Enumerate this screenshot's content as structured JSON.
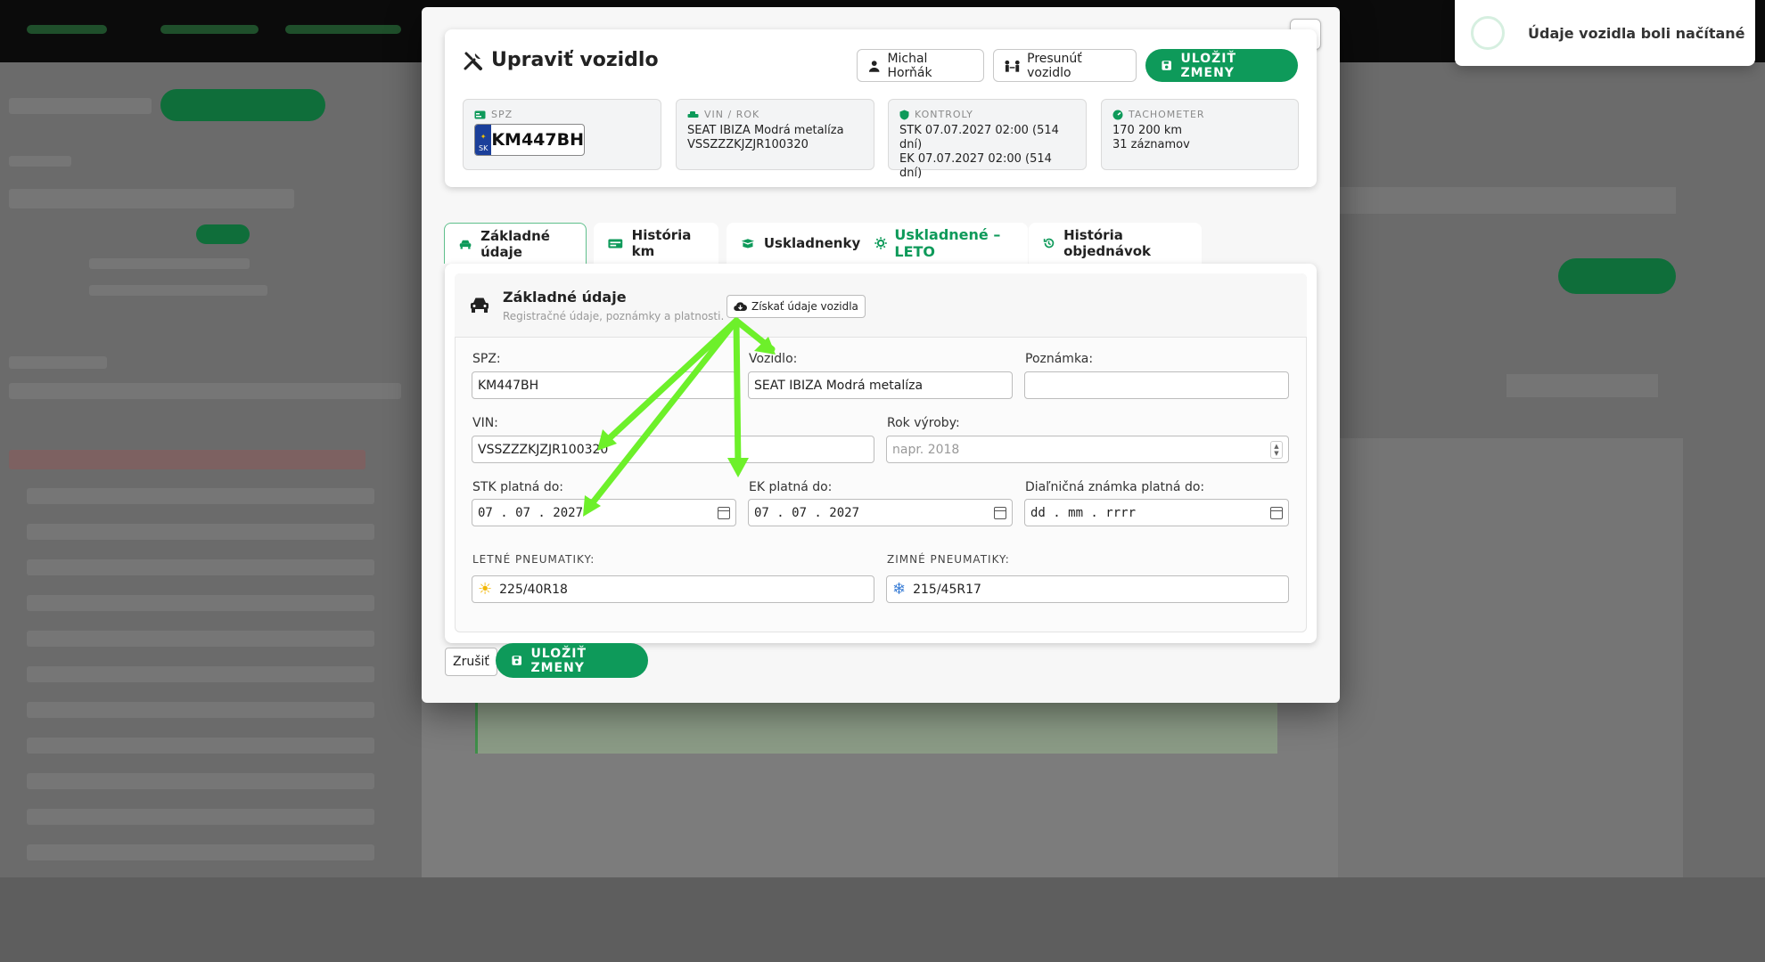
{
  "modal": {
    "title": "Upraviť vozidlo",
    "owner_button": "Michal Horňák",
    "move_button": "Presunúť vozidlo",
    "save_button": "ULOŽIŤ ZMENY",
    "close_label": "×"
  },
  "info": {
    "spz_label": "SPZ",
    "plate_country": "SK",
    "plate_number": "KM447BH",
    "vin_label": "VIN / ROK",
    "vin_line1": "SEAT IBIZA Modrá metalíza",
    "vin_line2": "VSSZZZKJZJR100320",
    "checks_label": "KONTROLY",
    "checks_line1": "STK 07.07.2027 02:00 (514 dní)",
    "checks_line2": "EK 07.07.2027 02:00 (514 dní)",
    "odo_label": "TACHOMETER",
    "odo_line1": "170 200 km",
    "odo_line2": "31 záznamov"
  },
  "tabs": [
    {
      "label": "Základné údaje"
    },
    {
      "label": "História km"
    },
    {
      "label": "Uskladnenky",
      "status": "Uskladnené – LETO"
    },
    {
      "label": "História objednávok"
    }
  ],
  "section": {
    "title": "Základné údaje",
    "subtitle": "Registračné údaje, poznámky a platnosti.",
    "fetch_button": "Získať údaje vozidla"
  },
  "form": {
    "spz_label": "SPZ:",
    "spz_value": "KM447BH",
    "vehicle_label": "Vozidlo:",
    "vehicle_value": "SEAT IBIZA Modrá metalíza",
    "note_label": "Poznámka:",
    "note_value": "",
    "vin_label": "VIN:",
    "vin_value": "VSSZZZKJZJR100320",
    "year_label": "Rok výroby:",
    "year_placeholder": "napr. 2018",
    "stk_label": "STK platná do:",
    "stk_value": "07 .  07 .  2027",
    "ek_label": "EK platná do:",
    "ek_value": "07 .  07 .  2027",
    "vignette_label": "Diaľničná známka platná do:",
    "vignette_value": "dd .  mm .  rrrr",
    "summer_label": "LETNÉ PNEUMATIKY:",
    "summer_value": "225/40R18",
    "winter_label": "ZIMNÉ PNEUMATIKY:",
    "winter_value": "215/45R17"
  },
  "footer": {
    "cancel": "Zrušiť",
    "save": "ULOŽIŤ ZMENY"
  },
  "toast": {
    "message": "Údaje vozidla boli načítané"
  },
  "colors": {
    "accent": "#0e9a5a",
    "arrow": "#6df02a",
    "plate_blue": "#1b3f9a"
  }
}
